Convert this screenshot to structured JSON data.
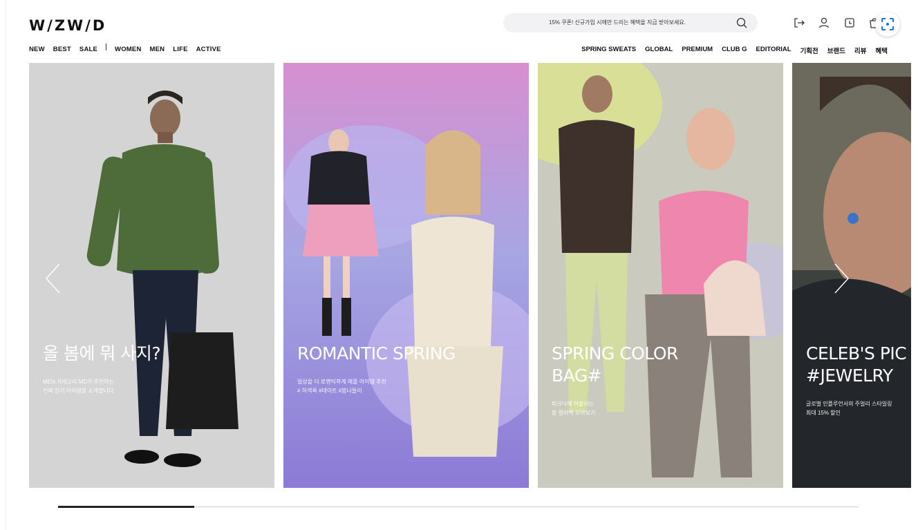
{
  "header": {
    "logo": "W/ZW/D",
    "search_placeholder": "15% 쿠폰! 신규가입 시에만 드리는 혜택을 지금 받아보세요."
  },
  "nav": {
    "left": [
      "NEW",
      "BEST",
      "SALE",
      "WOMEN",
      "MEN",
      "LIFE",
      "ACTIVE"
    ],
    "right": [
      "SPRING SWEATS",
      "GLOBAL",
      "PREMIUM",
      "CLUB G",
      "EDITORIAL",
      "기획전",
      "브랜드",
      "리뷰",
      "혜택"
    ]
  },
  "banners": [
    {
      "title": "올 봄에 뭐 사지?",
      "sub": [
        "MEN 카테고리 MD가 추천하는",
        "진짜 인기 아이템을 소개합니다."
      ]
    },
    {
      "title": "ROMANTIC SPRING",
      "sub": [
        "일상을 더 로맨틱하게 해줄 아이템 추천",
        "# 하객룩 #데이트 #봄나들이"
      ]
    },
    {
      "title": "SPRING COLOR\nBAG#",
      "sub": [
        "피크닉에 어울리는",
        "봄 컬러백 모아보기"
      ]
    },
    {
      "title": "CELEB'S PIC\n#JEWELRY",
      "sub": [
        "글로벌 인플루언서의 주얼리 스타일링",
        "최대 15% 할인"
      ]
    }
  ],
  "carousel": {
    "progress": 0.17
  },
  "colors": {
    "text": "#111111",
    "search_bg": "#f2f2f4"
  },
  "icons": [
    "search-icon",
    "login-icon",
    "user-icon",
    "recent-view-icon",
    "cart-icon",
    "screen-capture-icon",
    "prev-arrow-icon",
    "next-arrow-icon"
  ]
}
